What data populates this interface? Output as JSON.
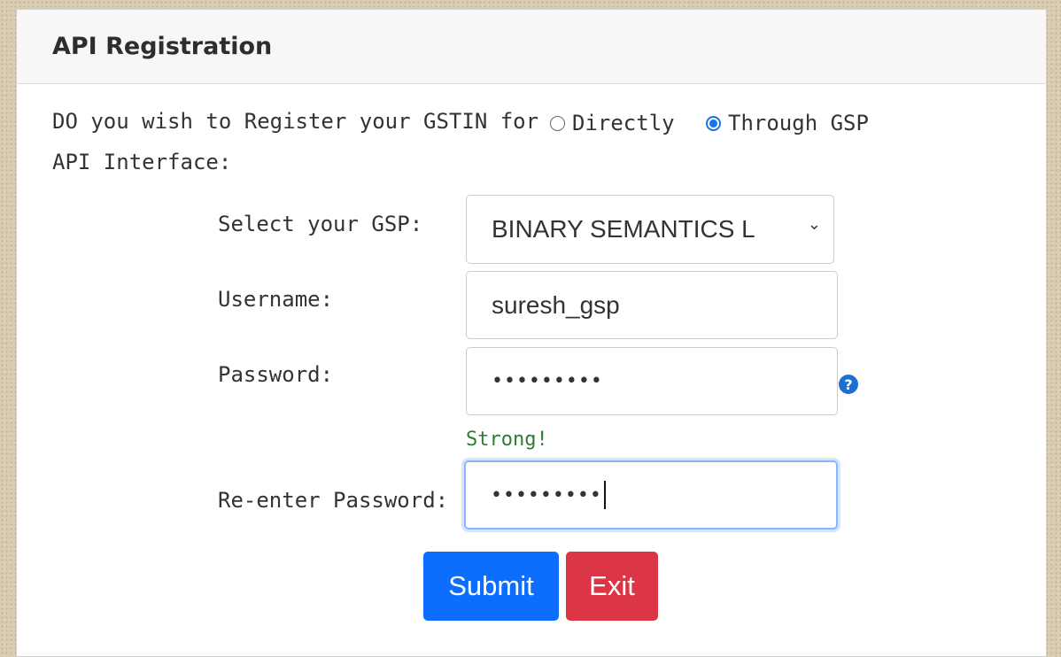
{
  "header": {
    "title": "API Registration"
  },
  "question": {
    "line1": "DO you wish to Register your GSTIN for",
    "line2": "API Interface:",
    "options": [
      {
        "label": "Directly",
        "selected": false
      },
      {
        "label": "Through GSP",
        "selected": true
      }
    ]
  },
  "form": {
    "gsp_label": "Select your GSP:",
    "gsp_value": "BINARY SEMANTICS L",
    "username_label": "Username:",
    "username_value": "suresh_gsp",
    "password_label": "Password:",
    "password_value": "•••••••••",
    "strength_text": "Strong!",
    "reenter_label": "Re-enter Password:",
    "reenter_value": "•••••••••"
  },
  "buttons": {
    "submit_label": "Submit",
    "exit_label": "Exit"
  },
  "colors": {
    "primary": "#0d6efd",
    "danger": "#dc3545",
    "strong": "#2e7d32",
    "help": "#1f6fd1"
  },
  "icons": {
    "help": "question-circle-icon",
    "dropdown": "chevron-down-icon"
  }
}
